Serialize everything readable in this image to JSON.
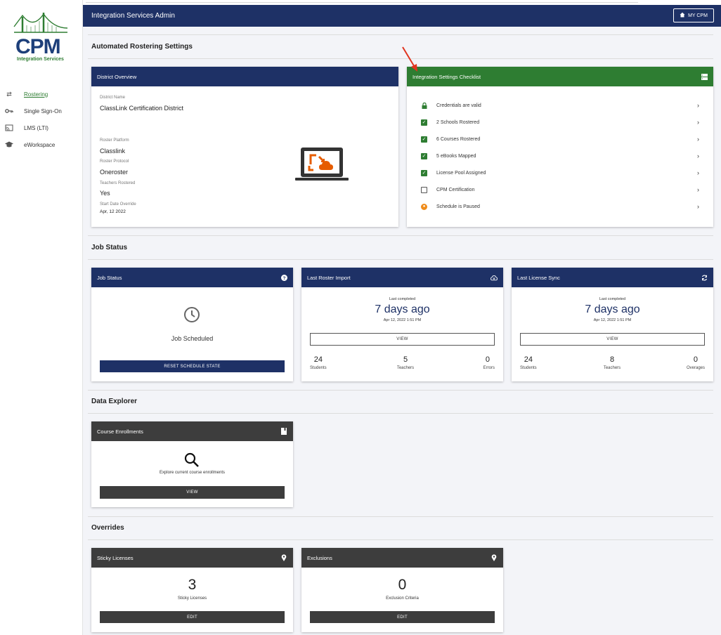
{
  "sidebar": {
    "logo_text": "CPM",
    "logo_sub": "Integration Services",
    "items": [
      {
        "label": "Rostering",
        "icon": "swap-icon"
      },
      {
        "label": "Single Sign-On",
        "icon": "key-icon"
      },
      {
        "label": "LMS (LTI)",
        "icon": "cast-icon"
      },
      {
        "label": "eWorkspace",
        "icon": "school-icon"
      }
    ]
  },
  "topbar": {
    "title": "Integration Services Admin",
    "my_cpm": "MY CPM"
  },
  "sections": {
    "rostering": "Automated Rostering Settings",
    "job_status": "Job Status",
    "data_explorer": "Data Explorer",
    "overrides": "Overrides"
  },
  "district": {
    "header": "District Overview",
    "name_label": "District Name",
    "name": "ClassLink Certification District",
    "platform_label": "Roster Platform",
    "platform": "Classlink",
    "protocol_label": "Roster Protocol",
    "protocol": "Oneroster",
    "teachers_label": "Teachers Rostered",
    "teachers": "Yes",
    "start_label": "Start Date Override",
    "start": "Apr, 12 2022"
  },
  "checklist": {
    "header": "Integration Settings Checklist",
    "items": [
      {
        "label": "Credentials are valid",
        "state": "lock"
      },
      {
        "label": "2 Schools Rostered",
        "state": "checked"
      },
      {
        "label": "6 Courses Rostered",
        "state": "checked"
      },
      {
        "label": "5 eBooks Mapped",
        "state": "checked"
      },
      {
        "label": "License Pool Assigned",
        "state": "checked"
      },
      {
        "label": "CPM Certification",
        "state": "empty"
      },
      {
        "label": "Schedule is Paused",
        "state": "warn"
      }
    ]
  },
  "job": {
    "header": "Job Status",
    "status": "Job Scheduled",
    "button": "RESET SCHEDULE STATE"
  },
  "roster_import": {
    "header": "Last Roster Import",
    "completed_label": "Last completed",
    "ago": "7 days ago",
    "timestamp": "Apr 12, 2022 1:51 PM",
    "view": "VIEW",
    "stats": [
      {
        "n": "24",
        "l": "Students"
      },
      {
        "n": "5",
        "l": "Teachers"
      },
      {
        "n": "0",
        "l": "Errors"
      }
    ]
  },
  "license_sync": {
    "header": "Last License Sync",
    "completed_label": "Last completed",
    "ago": "7 days ago",
    "timestamp": "Apr 12, 2022 1:51 PM",
    "view": "VIEW",
    "stats": [
      {
        "n": "24",
        "l": "Students"
      },
      {
        "n": "8",
        "l": "Teachers"
      },
      {
        "n": "0",
        "l": "Overages"
      }
    ]
  },
  "enrollments": {
    "header": "Course Enrollments",
    "desc": "Explore current course enrollments",
    "view": "VIEW"
  },
  "sticky": {
    "header": "Sticky Licenses",
    "count": "3",
    "label": "Sticky Licenses",
    "edit": "EDIT"
  },
  "exclusions": {
    "header": "Exclusions",
    "count": "0",
    "label": "Exclusion Criteria",
    "edit": "EDIT"
  },
  "colors": {
    "navy": "#1e3166",
    "green": "#2e7d32",
    "dark": "#3d3d3d",
    "orange": "#ef8c1b"
  }
}
